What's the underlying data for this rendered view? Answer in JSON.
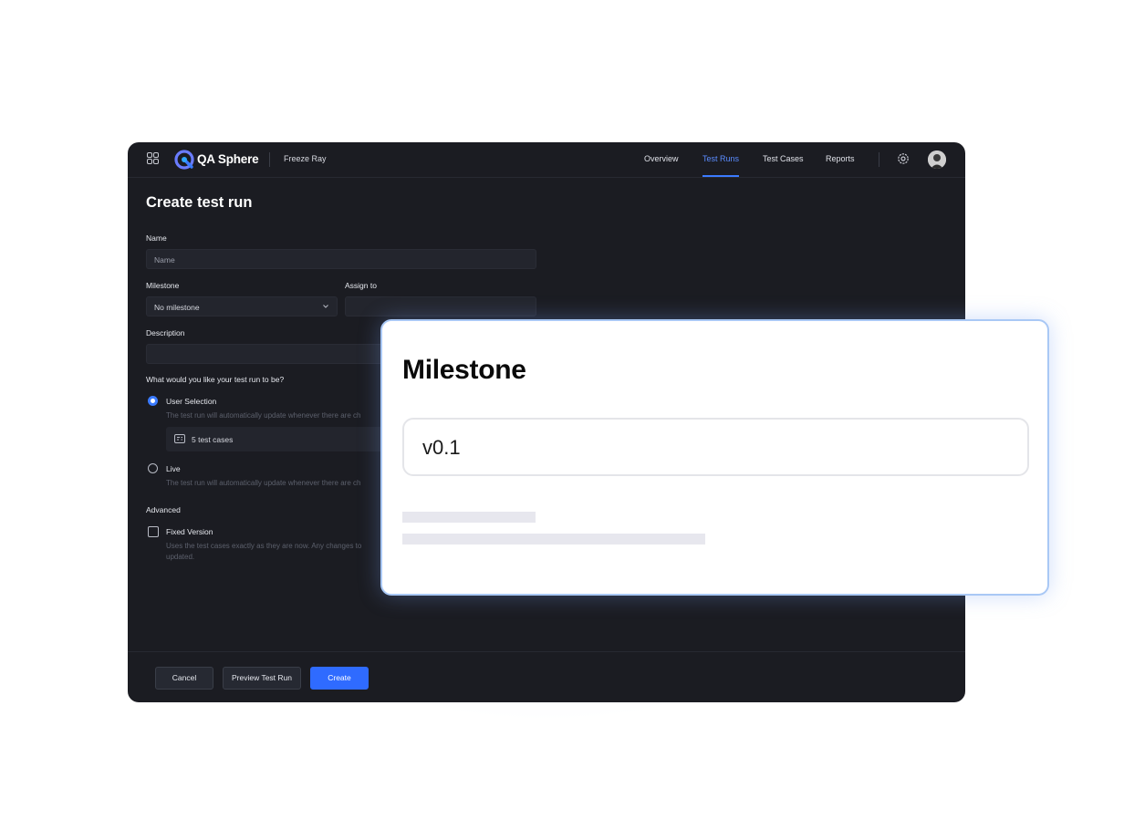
{
  "app": {
    "brand": "QA Sphere",
    "project": "Freeze Ray",
    "nav": [
      "Overview",
      "Test Runs",
      "Test Cases",
      "Reports"
    ],
    "active_nav": "Test Runs"
  },
  "form": {
    "title": "Create test run",
    "name_label": "Name",
    "name_placeholder": "Name",
    "milestone_label": "Milestone",
    "milestone_value": "No milestone",
    "assign_label": "Assign to",
    "assign_value": "",
    "description_label": "Description",
    "question": "What would you like your test run to be?",
    "options": [
      {
        "label": "User Selection",
        "desc": "The test run will automatically update whenever there are ch",
        "selected": true
      },
      {
        "label": "Live",
        "desc": "The test run will automatically update whenever there are ch",
        "selected": false
      }
    ],
    "cases_count": "5 test cases",
    "advanced_label": "Advanced",
    "fixed_version_label": "Fixed Version",
    "fixed_version_desc_1": "Uses the test cases exactly as they are now. Any changes to",
    "fixed_version_desc_2": "updated."
  },
  "footer": {
    "cancel": "Cancel",
    "preview": "Preview Test Run",
    "create": "Create"
  },
  "overlay": {
    "title": "Milestone",
    "value": "v0.1"
  },
  "colors": {
    "accent": "#2f6bff",
    "active_nav": "#5b8cff",
    "app_bg": "#1b1c22"
  }
}
